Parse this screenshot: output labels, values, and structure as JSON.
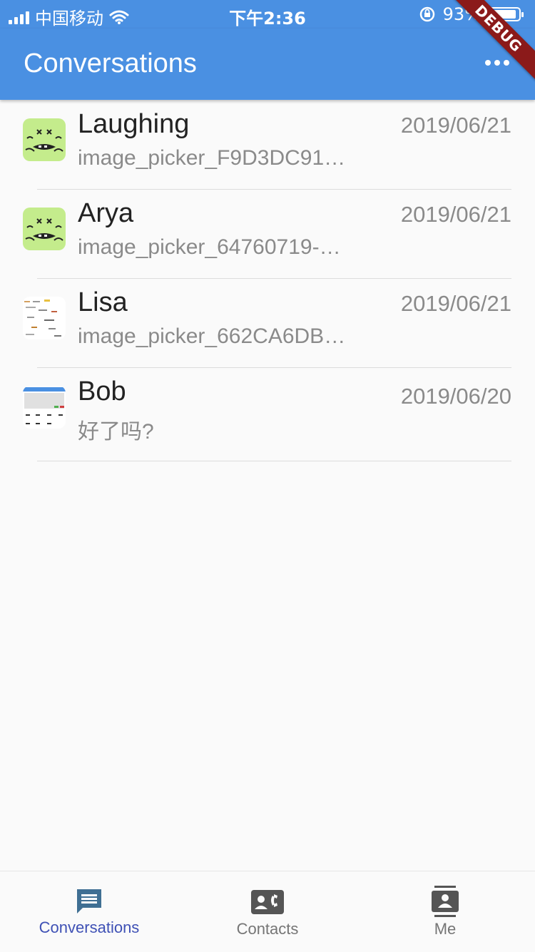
{
  "status_bar": {
    "carrier": "中国移动",
    "time": "下午2:36",
    "battery": "93%",
    "battery_level": 0.93
  },
  "app_bar": {
    "title": "Conversations",
    "more_icon": "more-horizontal-icon",
    "debug_label": "DEBUG"
  },
  "conversations": [
    {
      "name": "Laughing",
      "message": "image_picker_F9D3DC91…",
      "date": "2019/06/21",
      "avatar": "cartoon-face"
    },
    {
      "name": "Arya",
      "message": "image_picker_64760719-…",
      "date": "2019/06/21",
      "avatar": "cartoon-face"
    },
    {
      "name": "Lisa",
      "message": "image_picker_662CA6DB…",
      "date": "2019/06/21",
      "avatar": "screenshot-thumbnail"
    },
    {
      "name": "Bob",
      "message": "好了吗?",
      "date": "2019/06/20",
      "avatar": "screenshot-thumbnail"
    }
  ],
  "tabs": [
    {
      "label": "Conversations",
      "icon": "chat-icon",
      "active": true
    },
    {
      "label": "Contacts",
      "icon": "contacts-icon",
      "active": false
    },
    {
      "label": "Me",
      "icon": "profile-icon",
      "active": false
    }
  ],
  "colors": {
    "primary": "#4a90e2",
    "active_tab": "#3f51b5",
    "inactive_tab": "#757575",
    "debug_banner": "#8b1a1a"
  }
}
